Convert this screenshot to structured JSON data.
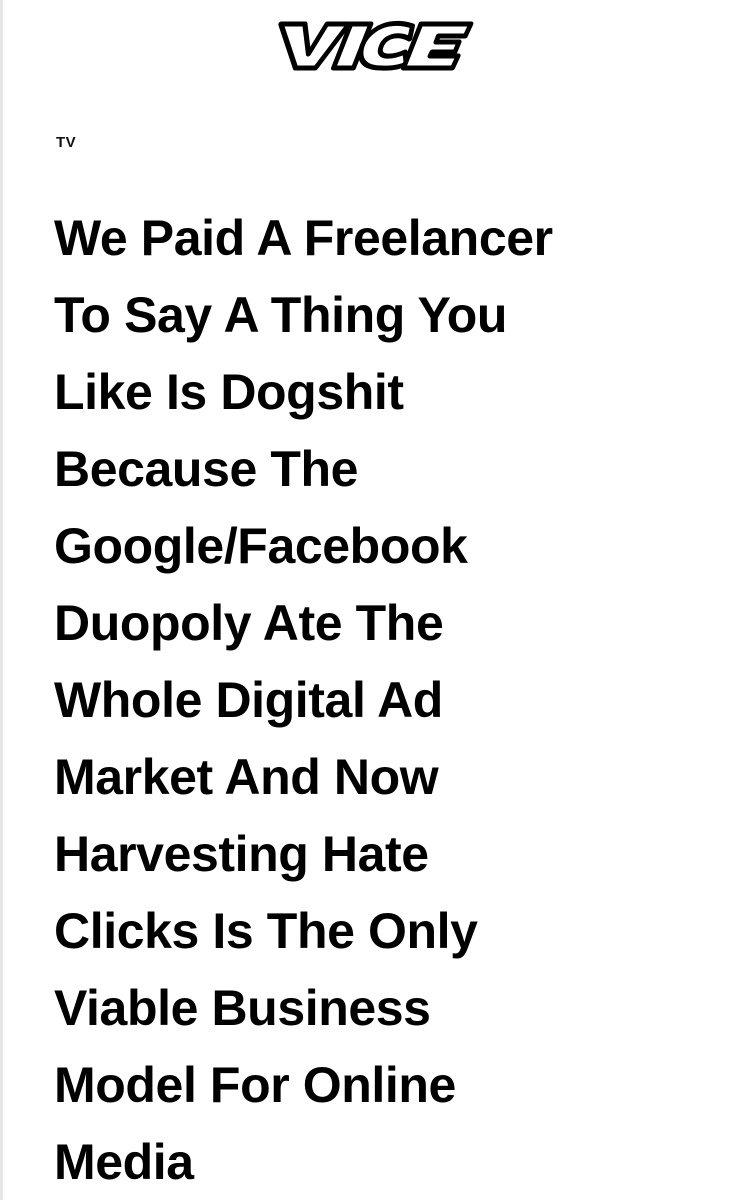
{
  "brand": {
    "logo_text": "VICE",
    "logo_icon": "vice-wordmark-logo"
  },
  "article": {
    "section": "TV",
    "headline_lines": [
      "We Paid A Freelancer",
      "To Say A Thing You",
      "Like Is Dogshit",
      "Because The",
      "Google/Facebook",
      "Duopoly Ate The",
      "Whole Digital Ad",
      "Market And Now",
      "Harvesting Hate",
      "Clicks Is The Only",
      "Viable Business",
      "Model For Online",
      "Media"
    ]
  },
  "colors": {
    "text": "#000000",
    "background": "#ffffff"
  }
}
